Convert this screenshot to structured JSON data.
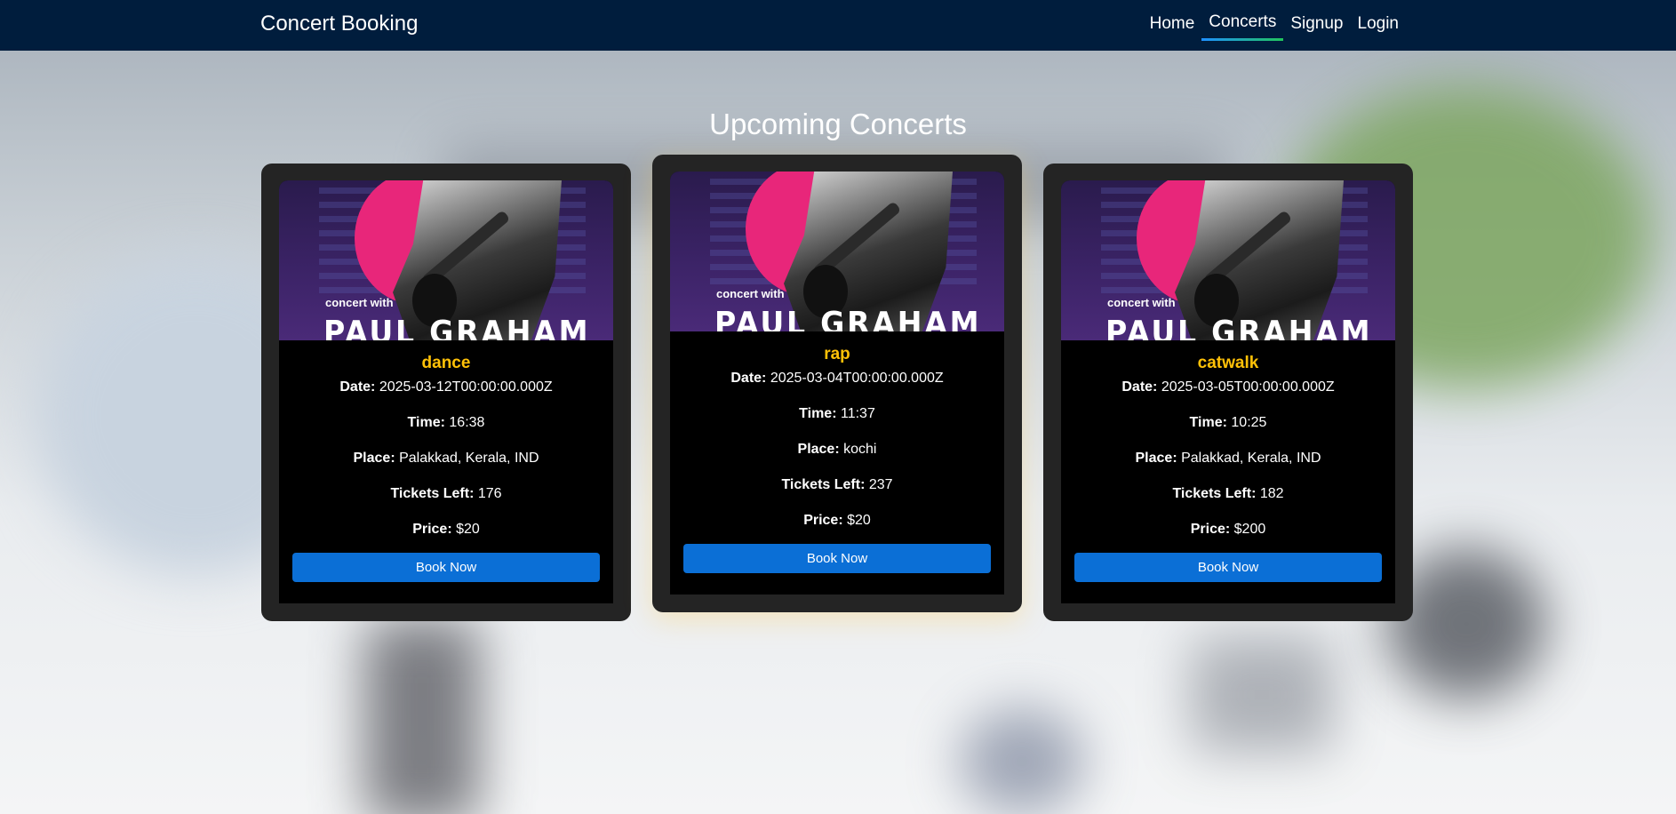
{
  "navbar": {
    "brand": "Concert Booking",
    "links": [
      "Home",
      "Concerts",
      "Signup",
      "Login"
    ],
    "active": "Concerts"
  },
  "heading": "Upcoming Concerts",
  "labels": {
    "date": "Date:",
    "time": "Time:",
    "place": "Place:",
    "tickets": "Tickets Left:",
    "price": "Price:"
  },
  "poster": {
    "subtitle": "concert with",
    "name": "PAUL GRAHAM"
  },
  "concerts": [
    {
      "title": "dance",
      "date": "2025-03-12T00:00:00.000Z",
      "time": "16:38",
      "place": "Palakkad, Kerala, IND",
      "tickets_left": "176",
      "price": "$20",
      "button": "Book Now"
    },
    {
      "title": "rap",
      "date": "2025-03-04T00:00:00.000Z",
      "time": "11:37",
      "place": "kochi",
      "tickets_left": "237",
      "price": "$20",
      "button": "Book Now"
    },
    {
      "title": "catwalk",
      "date": "2025-03-05T00:00:00.000Z",
      "time": "10:25",
      "place": "Palakkad, Kerala, IND",
      "tickets_left": "182",
      "price": "$200",
      "button": "Book Now"
    }
  ],
  "colors": {
    "navbar": "#001d3d",
    "title": "#ffc107",
    "button": "#0b6fd6",
    "card": "#242424"
  }
}
